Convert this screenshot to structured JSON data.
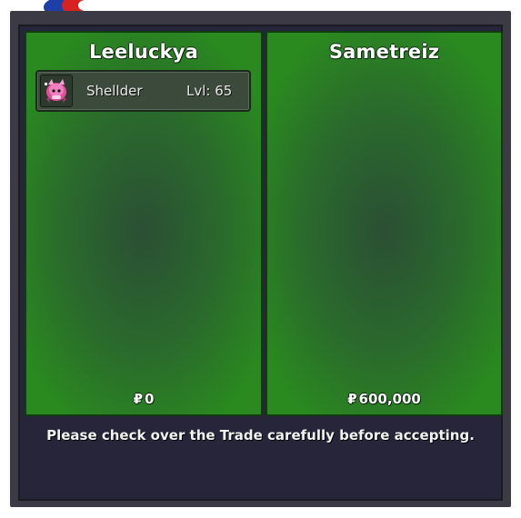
{
  "trade": {
    "left": {
      "player_name": "Leeluckya",
      "items": [
        {
          "name": "Shellder",
          "level": "Lvl: 65",
          "icon": "pokemon-sprite-icon"
        }
      ],
      "currency_symbol": "₽",
      "money": "0"
    },
    "right": {
      "player_name": "Sametreiz",
      "items": [],
      "currency_symbol": "₽",
      "money": "600,000"
    },
    "notice": "Please check over the Trade carefully before accepting."
  },
  "colors": {
    "panel_green": "#2a8a1f",
    "panel_center": "#2b4f34",
    "window_bg": "#26253a",
    "frame": "#3c3b45"
  }
}
